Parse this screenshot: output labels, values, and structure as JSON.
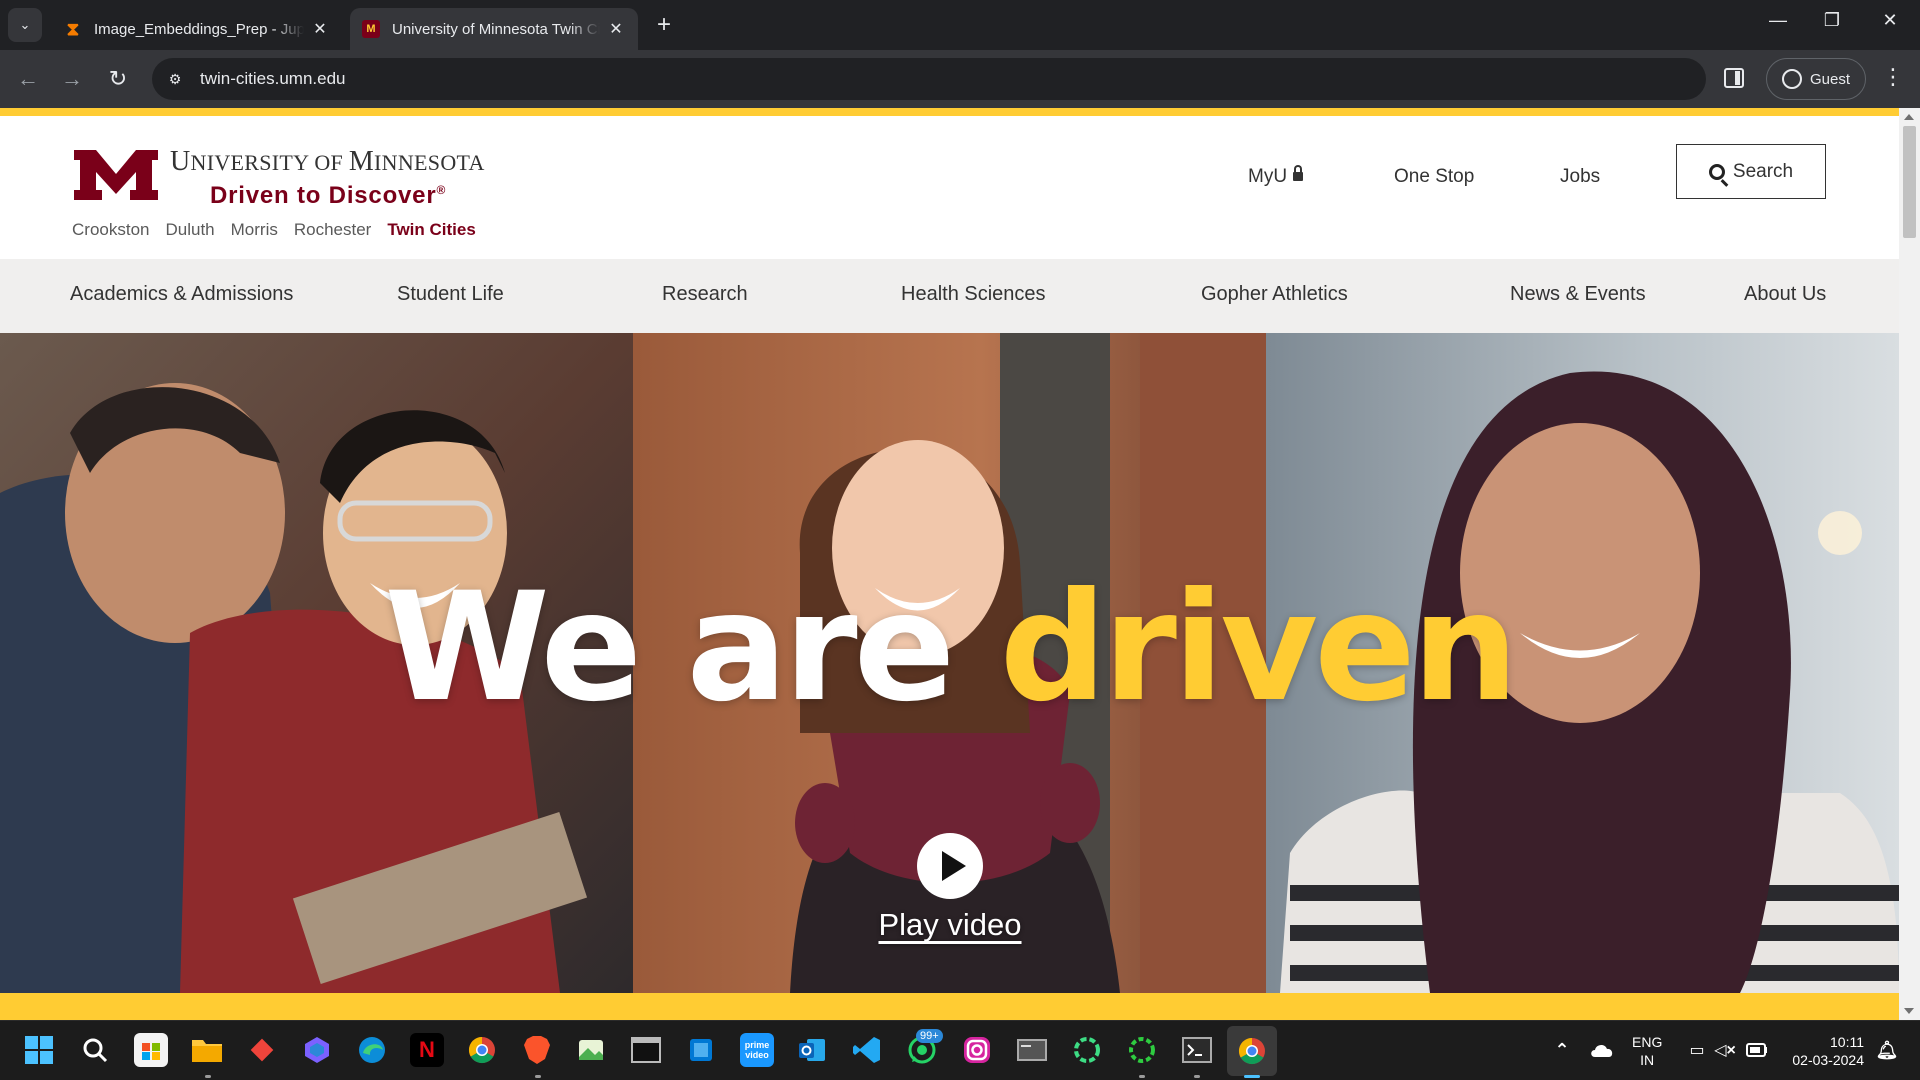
{
  "browser": {
    "tabs": [
      {
        "title": "Image_Embeddings_Prep - Jupyter",
        "active": false
      },
      {
        "title": "University of Minnesota Twin Cities",
        "active": true
      }
    ],
    "url": "twin-cities.umn.edu",
    "profile_label": "Guest"
  },
  "header": {
    "university_first": "U",
    "university_rest": "NIVERSITY OF ",
    "university_m": "M",
    "university_rest2": "INNESOTA",
    "tagline": "Driven to Discover",
    "tagline_mark": "®",
    "campuses": [
      "Crookston",
      "Duluth",
      "Morris",
      "Rochester",
      "Twin Cities"
    ],
    "current_campus": "Twin Cities",
    "utility_links": {
      "myu": "MyU",
      "one_stop": "One Stop",
      "jobs": "Jobs"
    },
    "search_label": "Search"
  },
  "mainnav": {
    "items": [
      "Academics & Admissions",
      "Student Life",
      "Research",
      "Health Sciences",
      "Gopher Athletics",
      "News & Events",
      "About Us"
    ]
  },
  "hero": {
    "title_white": "We are ",
    "title_gold": "driven",
    "play_label": "Play video"
  },
  "colors": {
    "maroon": "#7a0019",
    "gold": "#ffcc33"
  },
  "taskbar": {
    "apps": [
      "windows-start-icon",
      "search-icon",
      "store-icon",
      "file-explorer-icon",
      "anydesk-icon",
      "copilot-icon",
      "edge-icon",
      "netflix-icon",
      "chrome-icon",
      "brave-icon",
      "photos-icon",
      "terminal-icon",
      "windows-app-icon",
      "prime-video-icon",
      "outlook-icon",
      "vscode-icon",
      "whatsapp-icon",
      "instagram-icon",
      "window-icon",
      "green-ring-icon",
      "green-ring-2-icon",
      "cmd-icon",
      "chrome-active-icon"
    ],
    "whatsapp_badge": "99+",
    "language_line1": "ENG",
    "language_line2": "IN",
    "time": "10:11",
    "date": "02-03-2024"
  }
}
